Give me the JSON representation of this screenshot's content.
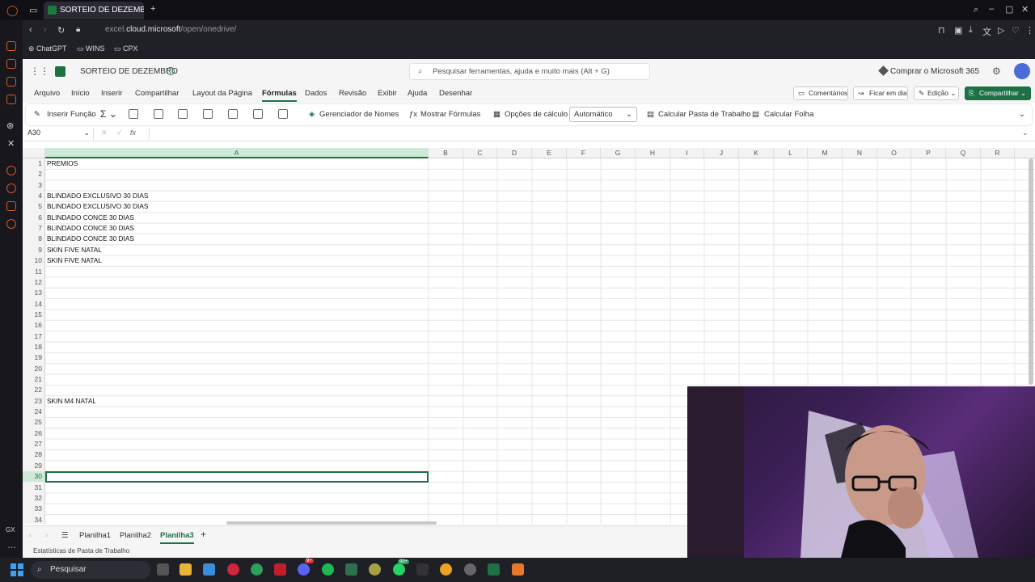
{
  "browser": {
    "tab_title": "SORTEIO DE DEZEMBRO",
    "url_prefix": "excel.",
    "url_domain": "cloud.microsoft",
    "url_path": "/open/onedrive/",
    "bookmarks": [
      "ChatGPT",
      "WINS",
      "CPX"
    ]
  },
  "excel": {
    "workbook_title": "SORTEIO DE DEZEMBRO",
    "search_placeholder": "Pesquisar ferramentas, ajuda e muito mais (Alt + G)",
    "buy_label": "Comprar o Microsoft 365",
    "menu": [
      "Arquivo",
      "Início",
      "Inserir",
      "Compartilhar",
      "Layout da Página",
      "Fórmulas",
      "Dados",
      "Revisão",
      "Exibir",
      "Ajuda",
      "Desenhar"
    ],
    "active_menu": "Fórmulas",
    "comments_label": "Comentários",
    "stay_label": "Ficar em dia",
    "edit_label": "Edição",
    "share_label": "Compartilhar",
    "ribbon": {
      "insert_function": "Inserir Função",
      "name_manager": "Gerenciador de Nomes",
      "show_formulas": "Mostrar Fórmulas",
      "calc_options": "Opções de cálculo",
      "calc_value": "Automático",
      "calc_workbook": "Calcular Pasta de Trabalho",
      "calc_sheet": "Calcular Folha"
    },
    "name_box": "A30",
    "fx_label": "fx",
    "columns": [
      "A",
      "B",
      "C",
      "D",
      "E",
      "F",
      "G",
      "H",
      "I",
      "J",
      "K",
      "L",
      "M",
      "N",
      "O",
      "P",
      "Q",
      "R"
    ],
    "rows": [
      "1",
      "2",
      "3",
      "4",
      "5",
      "6",
      "7",
      "8",
      "9",
      "10",
      "11",
      "12",
      "13",
      "14",
      "15",
      "16",
      "17",
      "18",
      "19",
      "20",
      "21",
      "22",
      "23",
      "24",
      "25",
      "26",
      "27",
      "28",
      "29",
      "30",
      "31",
      "32",
      "33",
      "34"
    ],
    "cells": {
      "r1": "PREMIOS",
      "r4": "BLINDADO EXCLUSIVO 30 DIAS",
      "r5": "BLINDADO EXCLUSIVO 30 DIAS",
      "r6": "BLINDADO CONCE 30 DIAS",
      "r7": "BLINDADO CONCE 30 DIAS",
      "r8": "BLINDADO CONCE 30 DIAS",
      "r9": "SKIN FIVE NATAL",
      "r10": "SKIN FIVE NATAL",
      "r23": "SKIN M4 NATAL"
    },
    "sheets": [
      "Planilha1",
      "Planilha2",
      "Planilha3"
    ],
    "active_sheet": "Planilha3",
    "status": "Estatísticas de Pasta de Trabalho"
  },
  "taskbar": {
    "search_label": "Pesquisar",
    "badge_discord": "9+",
    "badge_whatsapp": "99+"
  }
}
